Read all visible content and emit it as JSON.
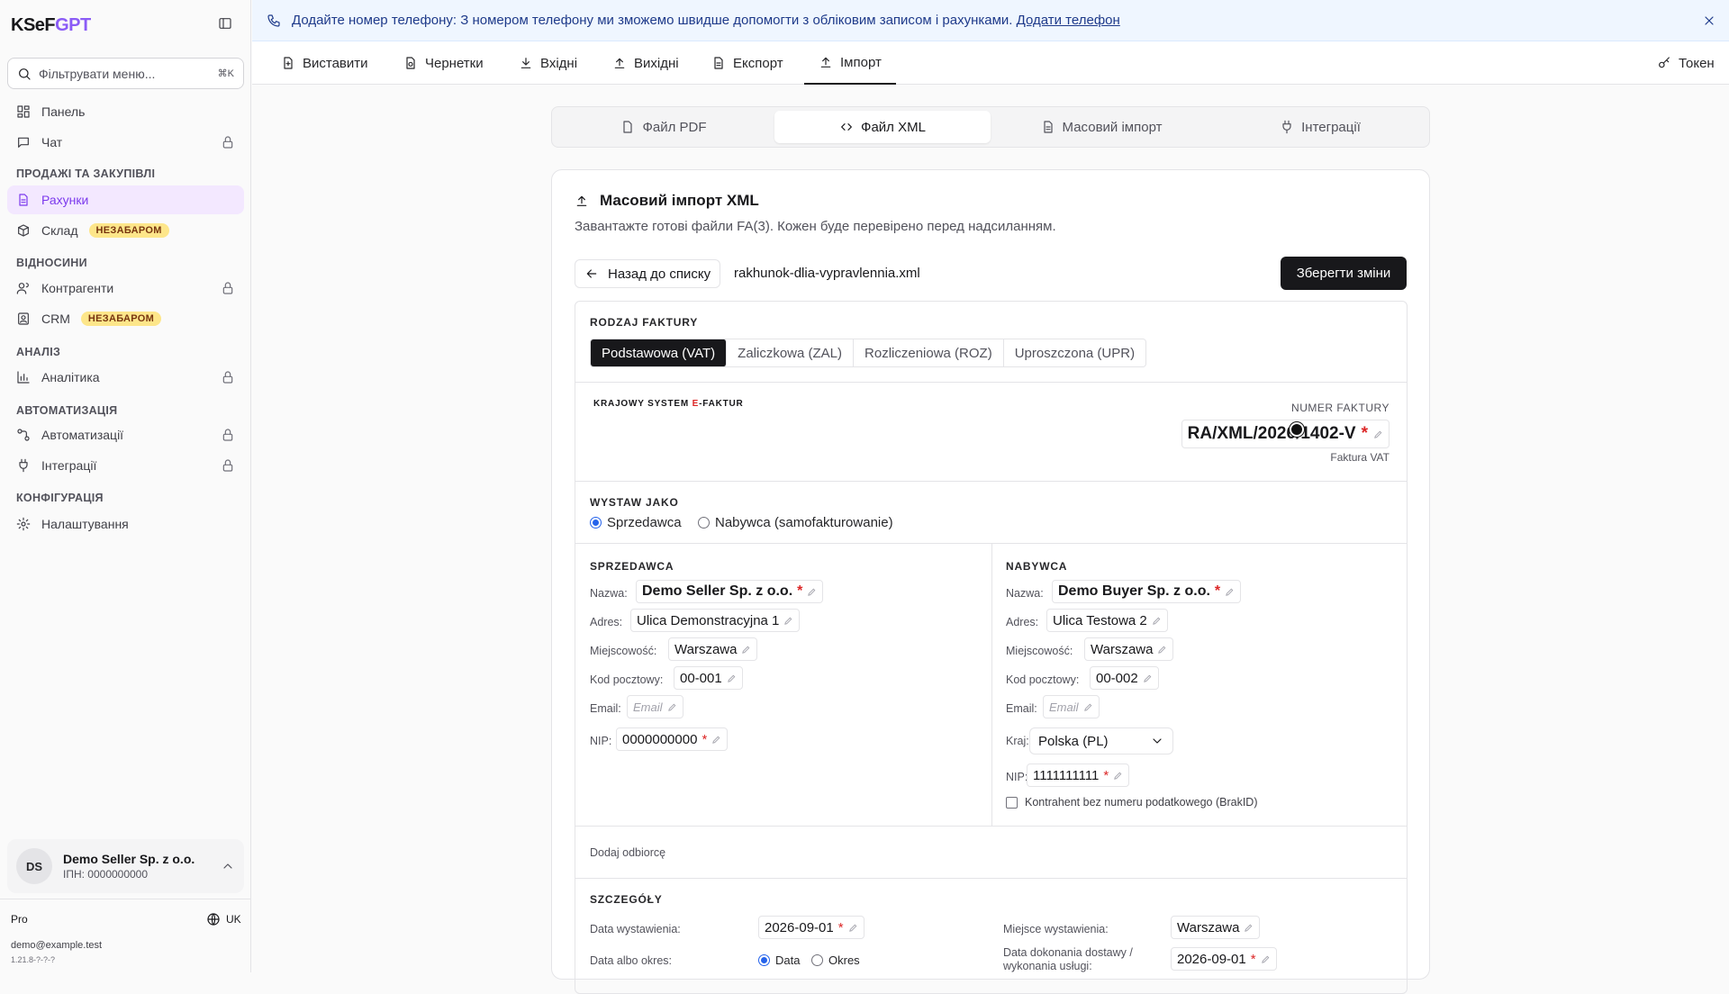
{
  "app": {
    "logo_main": "KSeF",
    "logo_accent": "GPT"
  },
  "sidebar": {
    "filter_placeholder": "Фільтрувати меню...",
    "filter_shortcut": "⌘K",
    "items": [
      {
        "label": "Панель",
        "icon": "dashboard-icon"
      },
      {
        "label": "Чат",
        "icon": "chat-icon",
        "locked": true
      },
      {
        "label": "Рахунки",
        "icon": "document-icon",
        "active": true
      },
      {
        "label": "Склад",
        "icon": "package-icon",
        "badge": "НЕЗАБАРОМ"
      },
      {
        "label": "Контрагенти",
        "icon": "users-icon",
        "locked": true
      },
      {
        "label": "CRM",
        "icon": "contact-icon",
        "badge": "НЕЗАБАРОМ"
      },
      {
        "label": "Аналітика",
        "icon": "chart-icon",
        "locked": true
      },
      {
        "label": "Автоматизації",
        "icon": "workflow-icon",
        "locked": true
      },
      {
        "label": "Інтеграції",
        "icon": "plug-icon",
        "locked": true
      },
      {
        "label": "Налаштування",
        "icon": "gear-icon"
      }
    ],
    "sections": [
      "ПРОДАЖІ ТА ЗАКУПІВЛІ",
      "ВІДНОСИНИ",
      "АНАЛІЗ",
      "АВТОМАТИЗАЦІЯ",
      "КОНФІГУРАЦІЯ"
    ],
    "account": {
      "initials": "DS",
      "name": "Demo Seller Sp. z o.o.",
      "sub": "ІПН: 0000000000"
    },
    "plan": "Pro",
    "lang": "UK",
    "email": "demo@example.test",
    "version": "1.21.8-?-?-?"
  },
  "banner": {
    "text": "Додайте номер телефону: З номером телефону ми зможемо швидше допомогти з обліковим записом і рахунками.",
    "link": "Додати телефон"
  },
  "topnav": {
    "tabs": [
      "Виставити",
      "Чернетки",
      "Вхідні",
      "Вихідні",
      "Експорт",
      "Імпорт"
    ],
    "active": "Імпорт",
    "token": "Токен"
  },
  "import_tabs": {
    "tabs": [
      "Файл PDF",
      "Файл XML",
      "Масовий імпорт",
      "Інтеграції"
    ],
    "active": "Файл XML"
  },
  "card": {
    "title": "Масовий імпорт XML",
    "description": "Завантажте готові файли FA(3). Кожен буде перевірено перед надсиланням.",
    "back_label": "Назад до списку",
    "filename": "rakhunok-dlia-vypravlennia.xml",
    "save_label": "Зберегти зміни"
  },
  "invoice": {
    "type_heading": "RODZAJ FAKTURY",
    "types": [
      "Podstawowa (VAT)",
      "Zaliczkowa (ZAL)",
      "Rozliczeniowa (ROZ)",
      "Uproszczona (UPR)"
    ],
    "active_type": "Podstawowa (VAT)",
    "system_label": "KRAJOWY SYSTEM E-FAKTUR",
    "number_label": "NUMER FAKTURY",
    "number": "RA/XML/2026/1402-V",
    "invoice_kind": "Faktura VAT",
    "issue_as": {
      "heading": "WYSTAW JAKO",
      "options": [
        "Sprzedawca",
        "Nabywca (samofakturowanie)"
      ],
      "selected": "Sprzedawca"
    },
    "seller": {
      "heading": "SPRZEDAWCA",
      "labels": {
        "name": "Nazwa:",
        "address": "Adres:",
        "city": "Miejscowość:",
        "postal": "Kod pocztowy:",
        "email": "Email:",
        "nip": "NIP:"
      },
      "name": "Demo Seller Sp. z o.o.",
      "address": "Ulica Demonstracyjna 1",
      "city": "Warszawa",
      "postal": "00-001",
      "email_placeholder": "Email",
      "nip": "0000000000"
    },
    "buyer": {
      "heading": "NABYWCA",
      "labels": {
        "name": "Nazwa:",
        "address": "Adres:",
        "city": "Miejscowość:",
        "postal": "Kod pocztowy:",
        "email": "Email:",
        "country": "Kraj:",
        "nip": "NIP:"
      },
      "name": "Demo Buyer Sp. z o.o.",
      "address": "Ulica Testowa 2",
      "city": "Warszawa",
      "postal": "00-002",
      "email_placeholder": "Email",
      "country": "Polska (PL)",
      "nip": "1111111111",
      "brak_id": "Kontrahent bez numeru podatkowego (BrakID)"
    },
    "add_recipient": "Dodaj odbiorcę",
    "details": {
      "heading": "SZCZEGÓŁY",
      "issue_date_label": "Data wystawienia:",
      "issue_date": "2026-09-01",
      "date_or_period_label": "Data albo okres:",
      "date_options": [
        "Data",
        "Okres"
      ],
      "date_selected": "Data",
      "place_label": "Miejsce wystawienia:",
      "place": "Warszawa",
      "delivery_label": "Data dokonania dostawy / wykonania usługi:",
      "delivery_date": "2026-09-01"
    }
  },
  "colors": {
    "accent": "#8b5cf6",
    "active_bg": "#f3e8ff",
    "banner_bg": "#eff6ff",
    "badge_bg": "#fde68a",
    "required": "#dc2626",
    "primary_button": "#18181b"
  }
}
